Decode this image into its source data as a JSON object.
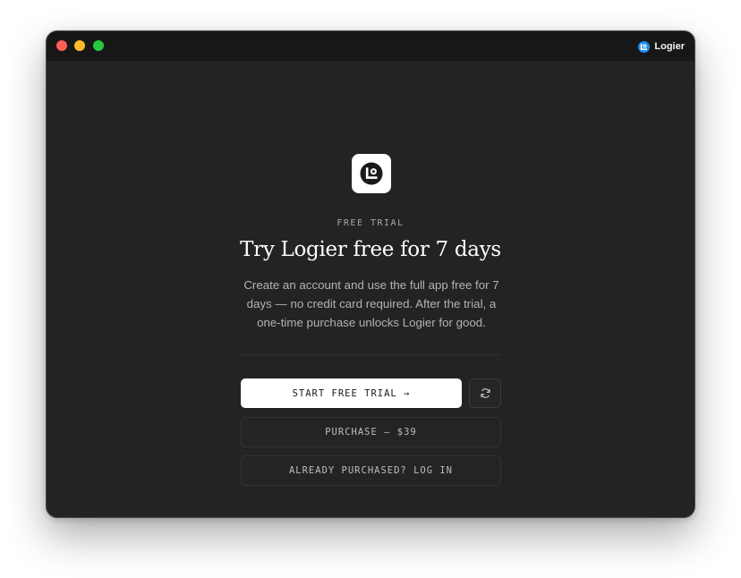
{
  "titlebar": {
    "app_name": "Logier",
    "brand_icon": "logier-logo-icon",
    "traffic_lights": {
      "close_color": "#ff5f57",
      "minimize_color": "#febc2e",
      "maximize_color": "#28c840"
    }
  },
  "hero": {
    "logo_icon": "logier-logo-icon",
    "eyebrow": "FREE TRIAL",
    "title": "Try Logier free for 7 days",
    "description": "Create an account and use the full app free for 7 days — no credit card required. After the trial, a one-time purchase unlocks Logier for good."
  },
  "actions": {
    "start_trial_label": "START FREE TRIAL →",
    "refresh_icon": "refresh-icon",
    "purchase_label": "PURCHASE — $39",
    "login_label": "ALREADY PURCHASED? LOG IN"
  },
  "colors": {
    "window_background": "#232323",
    "titlebar_background": "#171717",
    "brand_blue": "#1b8cf0",
    "primary_button": "#ffffff"
  }
}
